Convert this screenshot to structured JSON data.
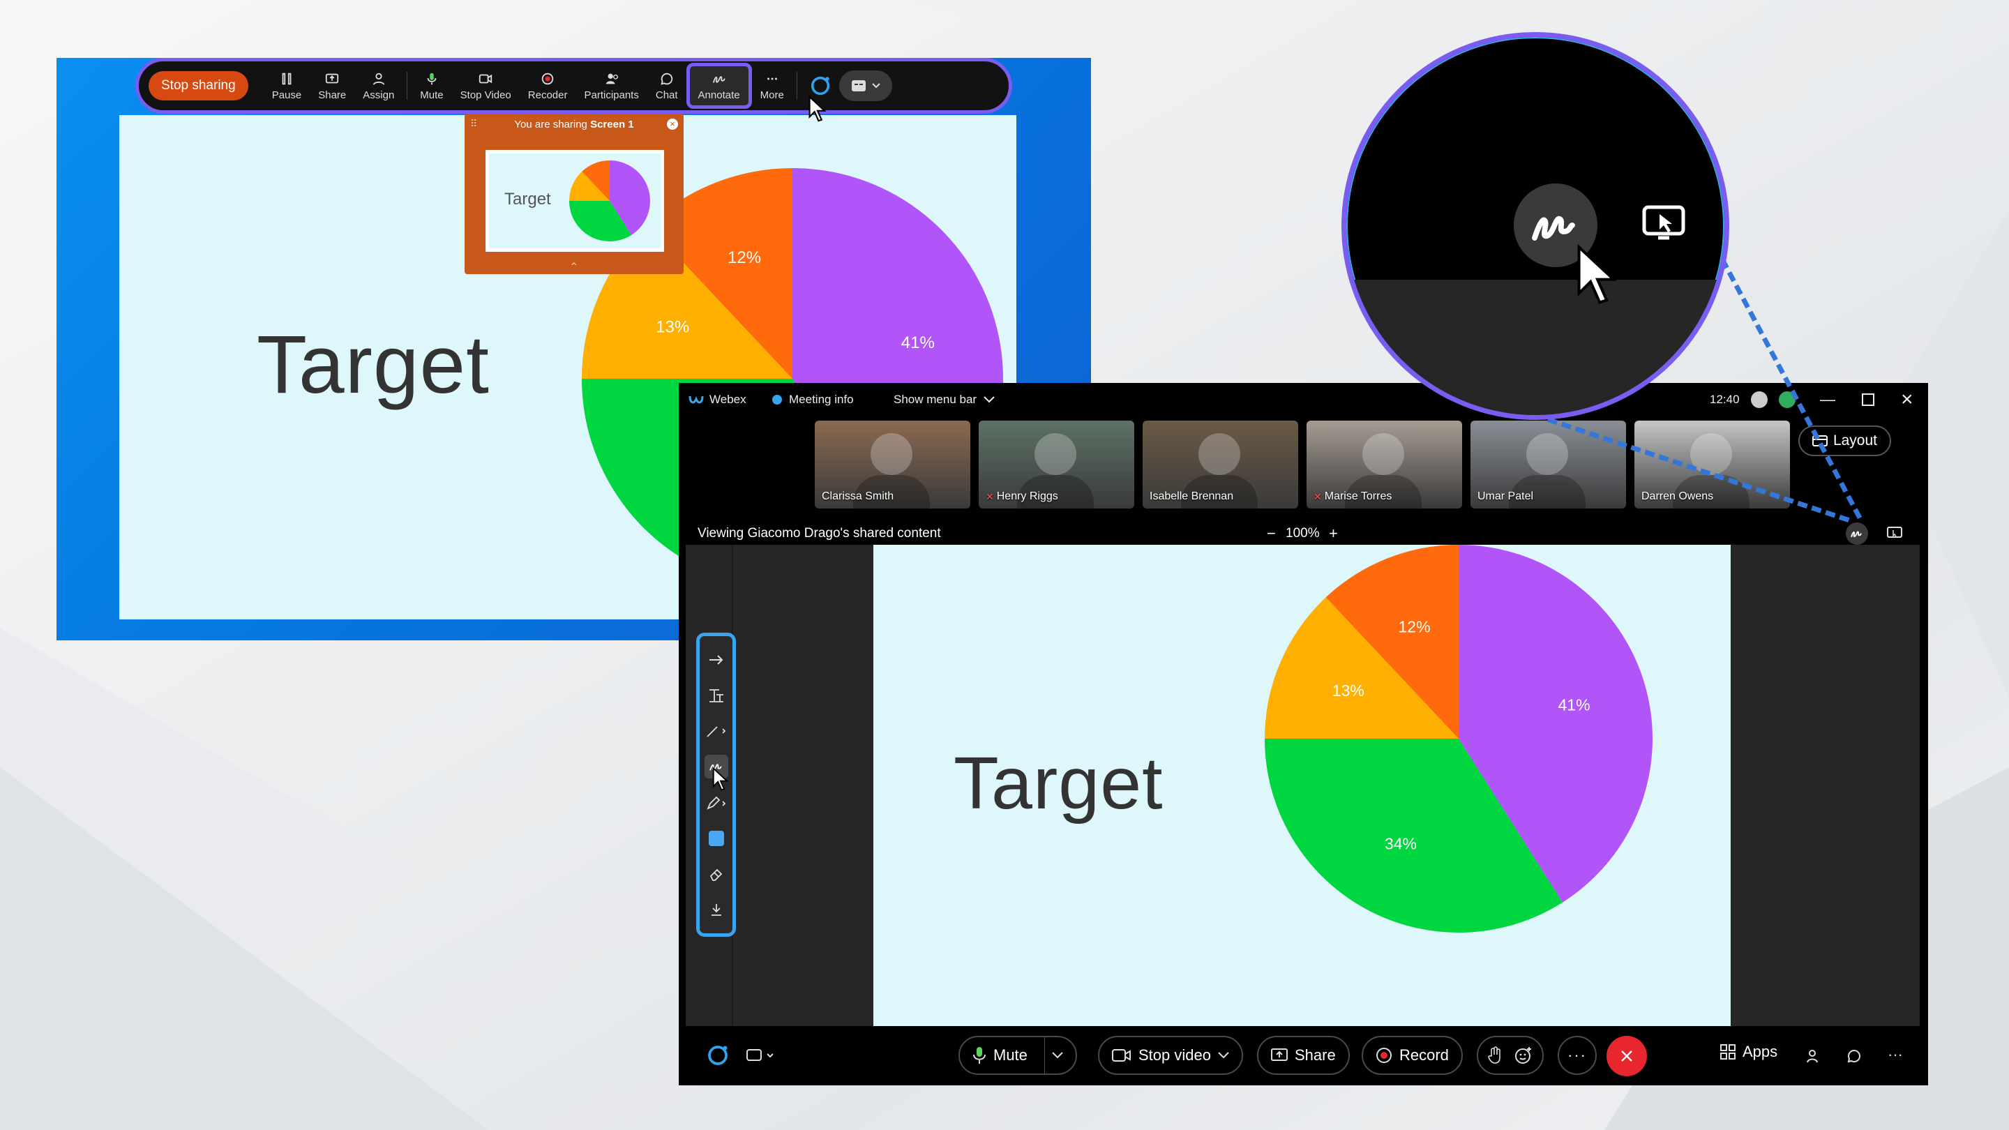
{
  "desktop_toolbar": {
    "stop_sharing": "Stop sharing",
    "items": [
      {
        "label": "Pause",
        "icon": "pause-icon"
      },
      {
        "label": "Share",
        "icon": "share-icon"
      },
      {
        "label": "Assign",
        "icon": "assign-icon"
      },
      {
        "label": "Mute",
        "icon": "microphone-icon"
      },
      {
        "label": "Stop Video",
        "icon": "video-icon"
      },
      {
        "label": "Recoder",
        "icon": "record-icon"
      },
      {
        "label": "Participants",
        "icon": "participants-icon"
      },
      {
        "label": "Chat",
        "icon": "chat-icon"
      },
      {
        "label": "Annotate",
        "icon": "annotate-icon"
      },
      {
        "label": "More",
        "icon": "more-icon"
      }
    ]
  },
  "share_panel": {
    "text": "You are sharing",
    "screen": "Screen 1"
  },
  "slide": {
    "title": "Target"
  },
  "chart_data": {
    "type": "pie",
    "labels": [
      "41%",
      "34%",
      "13%",
      "12%"
    ],
    "values": [
      41,
      34,
      13,
      12
    ],
    "colors": [
      "#b155f9",
      "#00d640",
      "#ffaf00",
      "#ff6a0d"
    ]
  },
  "meeting_window": {
    "app_name": "Webex",
    "meeting_info": "Meeting info",
    "show_menu_bar": "Show menu bar",
    "time": "12:40",
    "layout": "Layout",
    "participants": [
      {
        "name": "Clarissa Smith",
        "muted": false,
        "color": "#8a6a52"
      },
      {
        "name": "Henry Riggs",
        "muted": true,
        "color": "#5d7266"
      },
      {
        "name": "Isabelle Brennan",
        "muted": false,
        "color": "#6b5a45"
      },
      {
        "name": "Marise Torres",
        "muted": true,
        "color": "#a79c93"
      },
      {
        "name": "Umar Patel",
        "muted": false,
        "color": "#8a8f96"
      },
      {
        "name": "Darren Owens",
        "muted": false,
        "color": "#c4c6c8"
      }
    ],
    "viewing": "Viewing Giacomo Drago's shared content",
    "zoom": "100%",
    "zoom_minus": "−",
    "zoom_plus": "+",
    "controls": {
      "mute": "Mute",
      "stop_video": "Stop video",
      "share": "Share",
      "record": "Record",
      "apps": "Apps"
    }
  }
}
